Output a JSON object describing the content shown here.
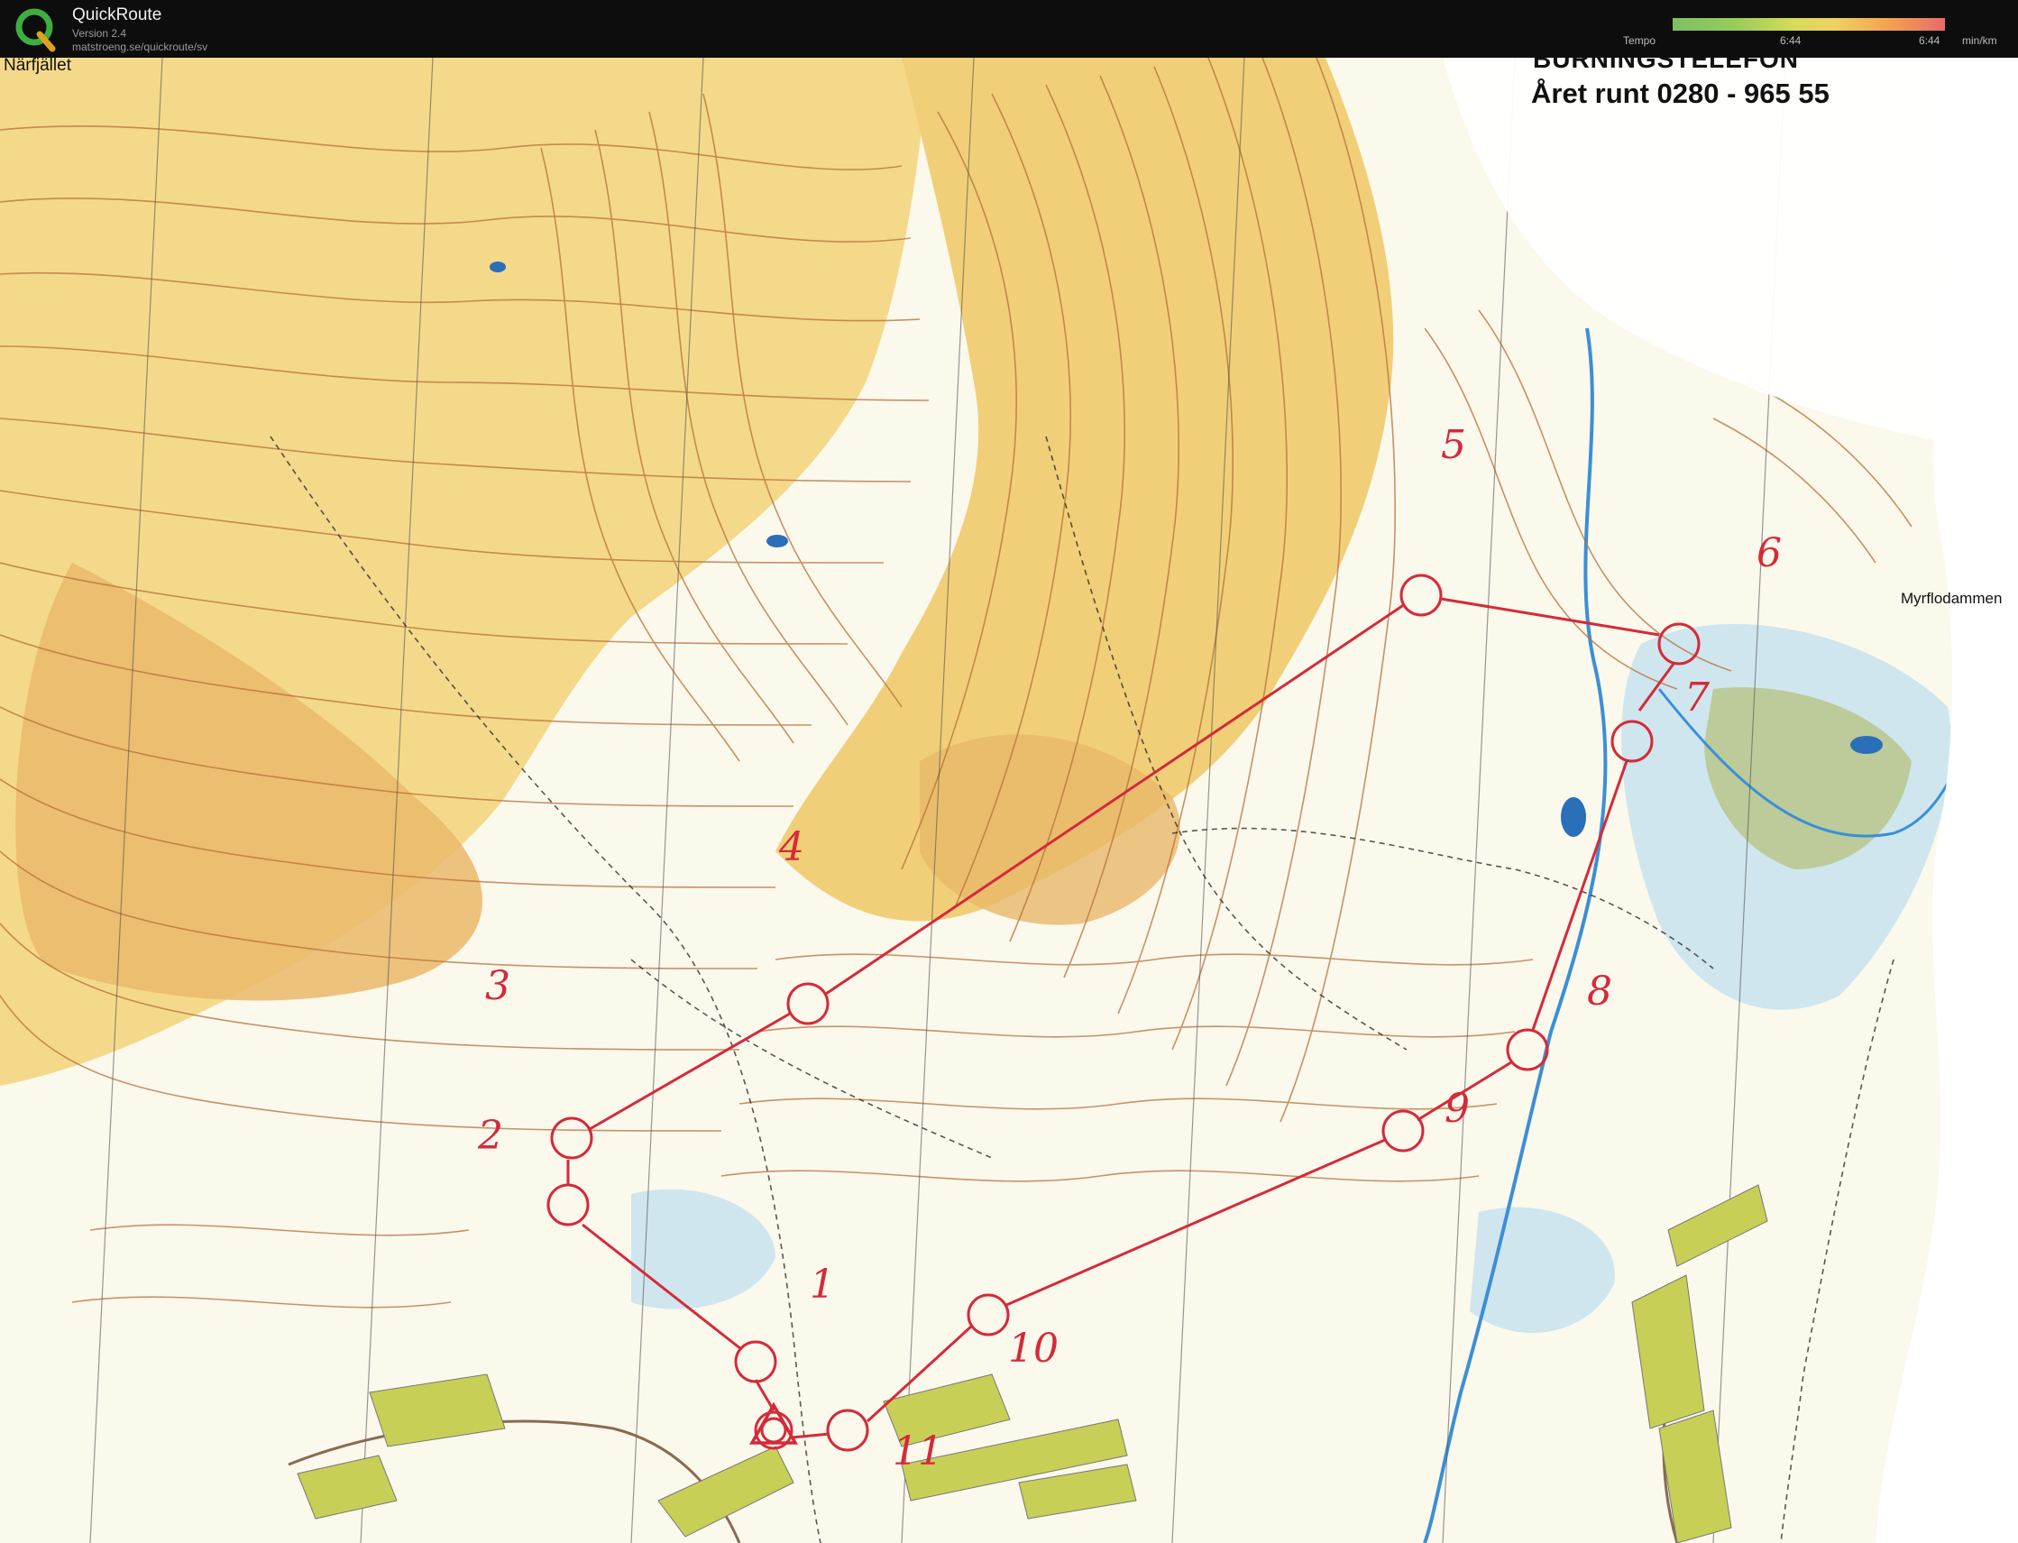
{
  "app": {
    "title": "QuickRoute",
    "version": "Version 2.4",
    "url": "matstroeng.se/quickroute/sv"
  },
  "legend": {
    "label": "Tempo",
    "tick_left": "6:44",
    "tick_right": "6:44",
    "unit": "min/km",
    "colors": [
      "#7dbf63",
      "#d7dc58",
      "#f2a24e",
      "#e66b6b"
    ]
  },
  "map": {
    "header_partial": "BURNINGSTELEFON",
    "header_phone": "Året runt 0280 - 965 55",
    "place_top_left": "Närfjället",
    "place_right": "Myrflodammen",
    "course_color": "#d42a3a",
    "controls": [
      "1",
      "2",
      "3",
      "4",
      "5",
      "6",
      "7",
      "8",
      "9",
      "10",
      "11"
    ]
  }
}
